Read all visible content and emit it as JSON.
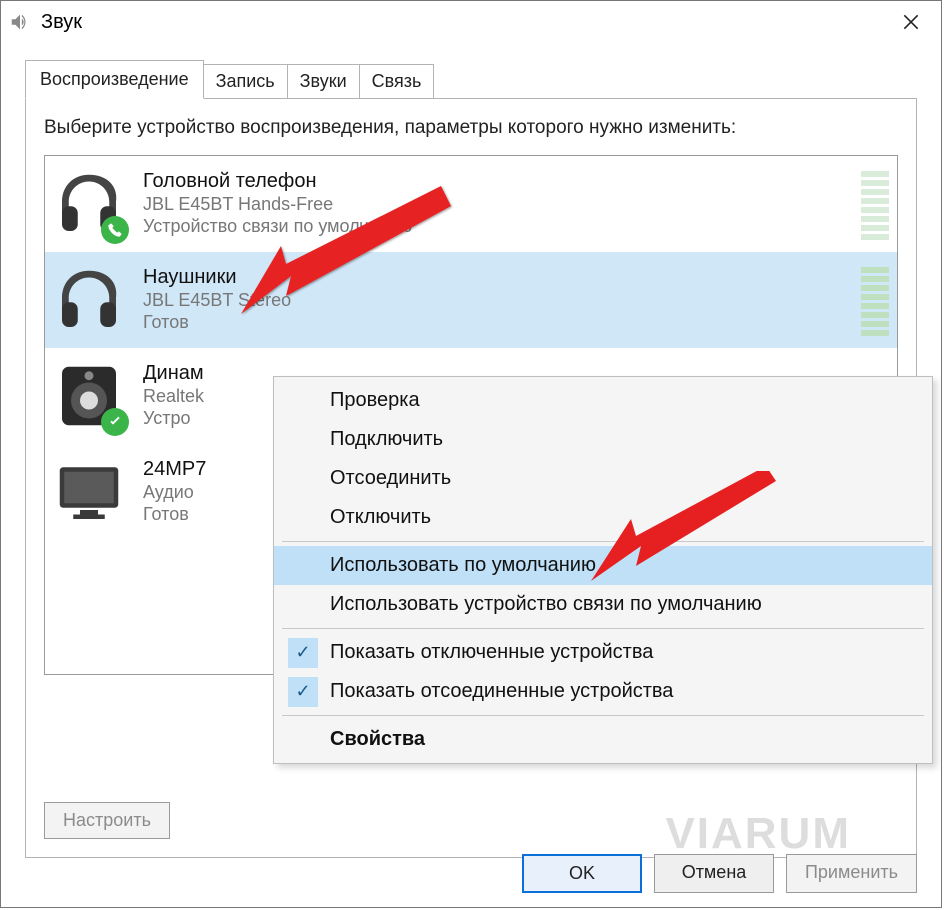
{
  "window": {
    "title": "Звук"
  },
  "tabs": [
    {
      "label": "Воспроизведение",
      "active": true
    },
    {
      "label": "Запись",
      "active": false
    },
    {
      "label": "Звуки",
      "active": false
    },
    {
      "label": "Связь",
      "active": false
    }
  ],
  "instruction": "Выберите устройство воспроизведения, параметры которого нужно изменить:",
  "devices": [
    {
      "title": "Головной телефон",
      "sub1": "JBL E45BT Hands-Free",
      "sub2": "Устройство связи по умолчанию",
      "badge": "phone",
      "icon": "headset",
      "selected": false
    },
    {
      "title": "Наушники",
      "sub1": "JBL E45BT Stereo",
      "sub2": "Готов",
      "badge": "",
      "icon": "headset",
      "selected": true
    },
    {
      "title": "Динам",
      "sub1": "Realtek",
      "sub2": "Устро",
      "badge": "check",
      "icon": "speaker",
      "selected": false
    },
    {
      "title": "24MP7",
      "sub1": "Аудио",
      "sub2": "Готов",
      "badge": "",
      "icon": "monitor",
      "selected": false
    }
  ],
  "context_menu": [
    {
      "label": "Проверка",
      "type": "item"
    },
    {
      "label": "Подключить",
      "type": "item"
    },
    {
      "label": "Отсоединить",
      "type": "item"
    },
    {
      "label": "Отключить",
      "type": "item"
    },
    {
      "type": "sep"
    },
    {
      "label": "Использовать по умолчанию",
      "type": "item",
      "highlight": true
    },
    {
      "label": "Использовать устройство связи по умолчанию",
      "type": "item"
    },
    {
      "type": "sep"
    },
    {
      "label": "Показать отключенные устройства",
      "type": "item",
      "checked": true
    },
    {
      "label": "Показать отсоединенные устройства",
      "type": "item",
      "checked": true
    },
    {
      "type": "sep"
    },
    {
      "label": "Свойства",
      "type": "item",
      "bold": true
    }
  ],
  "buttons": {
    "configure": "Настроить",
    "ok": "OK",
    "cancel": "Отмена",
    "apply": "Применить"
  },
  "watermark": "VIARUM"
}
